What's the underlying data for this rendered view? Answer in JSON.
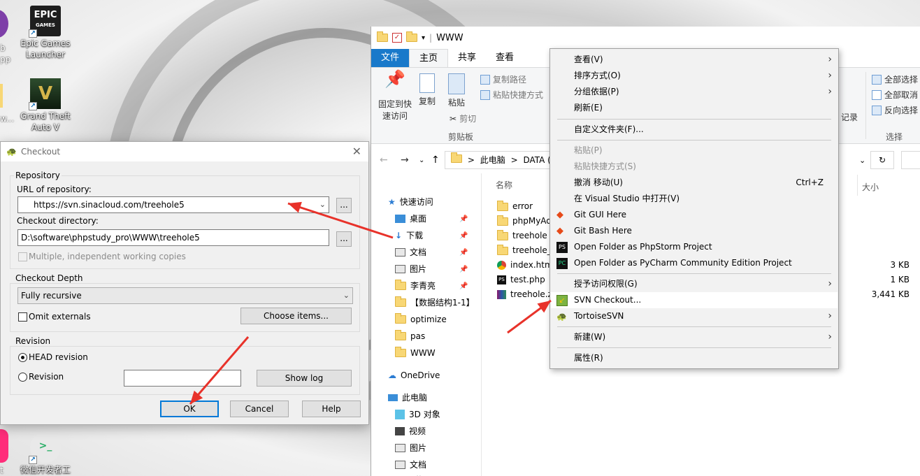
{
  "desktop": {
    "icons": [
      {
        "label_line1": "Epic Games",
        "label_line2": "Launcher",
        "logo_top": "EPIC",
        "logo_bottom": "GAMES"
      },
      {
        "label_line1": "Grand Theft",
        "label_line2": "Auto V",
        "logo": "V"
      },
      {
        "label_line1": "微信开发者工",
        "label_line2": ""
      }
    ],
    "edge_labels": [
      "b",
      "pp",
      "w...",
      "t"
    ]
  },
  "checkout_dialog": {
    "title": "Checkout",
    "repository_group": "Repository",
    "url_label": "URL of repository:",
    "url_value": "https://svn.sinacloud.com/treehole5",
    "checkout_dir_label": "Checkout directory:",
    "checkout_dir_value": "D:\\software\\phpstudy_pro\\WWW\\treehole5",
    "browse_label": "...",
    "multiple_copies_label": "Multiple, independent working copies",
    "depth_group": "Checkout Depth",
    "depth_value": "Fully recursive",
    "omit_externals_label": "Omit externals",
    "choose_items_label": "Choose items...",
    "revision_group": "Revision",
    "head_revision_label": "HEAD revision",
    "revision_label": "Revision",
    "show_log_label": "Show log",
    "ok_label": "OK",
    "cancel_label": "Cancel",
    "help_label": "Help"
  },
  "explorer": {
    "window_title": "WWW",
    "tabs": {
      "file": "文件",
      "home": "主页",
      "share": "共享",
      "view": "查看"
    },
    "ribbon": {
      "pin_line1": "固定到快",
      "pin_line2": "速访问",
      "copy": "复制",
      "paste": "粘贴",
      "copy_path": "复制路径",
      "paste_shortcut": "粘贴快捷方式",
      "cut": "剪切",
      "clipboard_group": "剪贴板",
      "select_all": "全部选择",
      "select_none": "全部取消",
      "invert_select": "反向选择",
      "select_group": "选择",
      "history_partial": "记录"
    },
    "address": {
      "this_pc": "此电脑",
      "drive": "DATA (D",
      "sep": ">"
    },
    "nav": {
      "quick_access": "快速访问",
      "items": [
        "桌面",
        "下载",
        "文档",
        "图片",
        "李青亮",
        "【数据结构1-1】",
        "optimize",
        "pas",
        "WWW"
      ],
      "onedrive": "OneDrive",
      "this_pc": "此电脑",
      "pc_items": [
        "3D 对象",
        "视频",
        "图片",
        "文档",
        "下载"
      ]
    },
    "columns": {
      "name": "名称",
      "size": "大小"
    },
    "files": [
      {
        "name": "error",
        "size": ""
      },
      {
        "name": "phpMyAd",
        "size": ""
      },
      {
        "name": "treehole",
        "size": ""
      },
      {
        "name": "treehole_s",
        "size": ""
      },
      {
        "name": "index.htm",
        "size": "3 KB"
      },
      {
        "name": "test.php",
        "size": "1 KB"
      },
      {
        "name": "treehole.z",
        "size": "3,441 KB"
      }
    ]
  },
  "context_menu": {
    "items": [
      {
        "label": "查看(V)",
        "submenu": true
      },
      {
        "label": "排序方式(O)",
        "submenu": true
      },
      {
        "label": "分组依据(P)",
        "submenu": true
      },
      {
        "label": "刷新(E)"
      },
      {
        "label": "自定义文件夹(F)..."
      },
      {
        "label": "粘贴(P)",
        "disabled": true
      },
      {
        "label": "粘贴快捷方式(S)",
        "disabled": true
      },
      {
        "label": "撤消 移动(U)",
        "shortcut": "Ctrl+Z"
      },
      {
        "label": "在 Visual Studio 中打开(V)"
      },
      {
        "label": "Git GUI Here"
      },
      {
        "label": "Git Bash Here"
      },
      {
        "label": "Open Folder as PhpStorm Project"
      },
      {
        "label": "Open Folder as PyCharm Community Edition Project"
      },
      {
        "label": "授予访问权限(G)",
        "submenu": true
      },
      {
        "label": "SVN Checkout..."
      },
      {
        "label": "TortoiseSVN",
        "submenu": true
      },
      {
        "label": "新建(W)",
        "submenu": true
      },
      {
        "label": "属性(R)"
      }
    ],
    "submenu_arrow": "›"
  },
  "colors": {
    "annotation_arrow": "#e8322a",
    "file_tab": "#1979ca",
    "accent": "#0078d7"
  }
}
